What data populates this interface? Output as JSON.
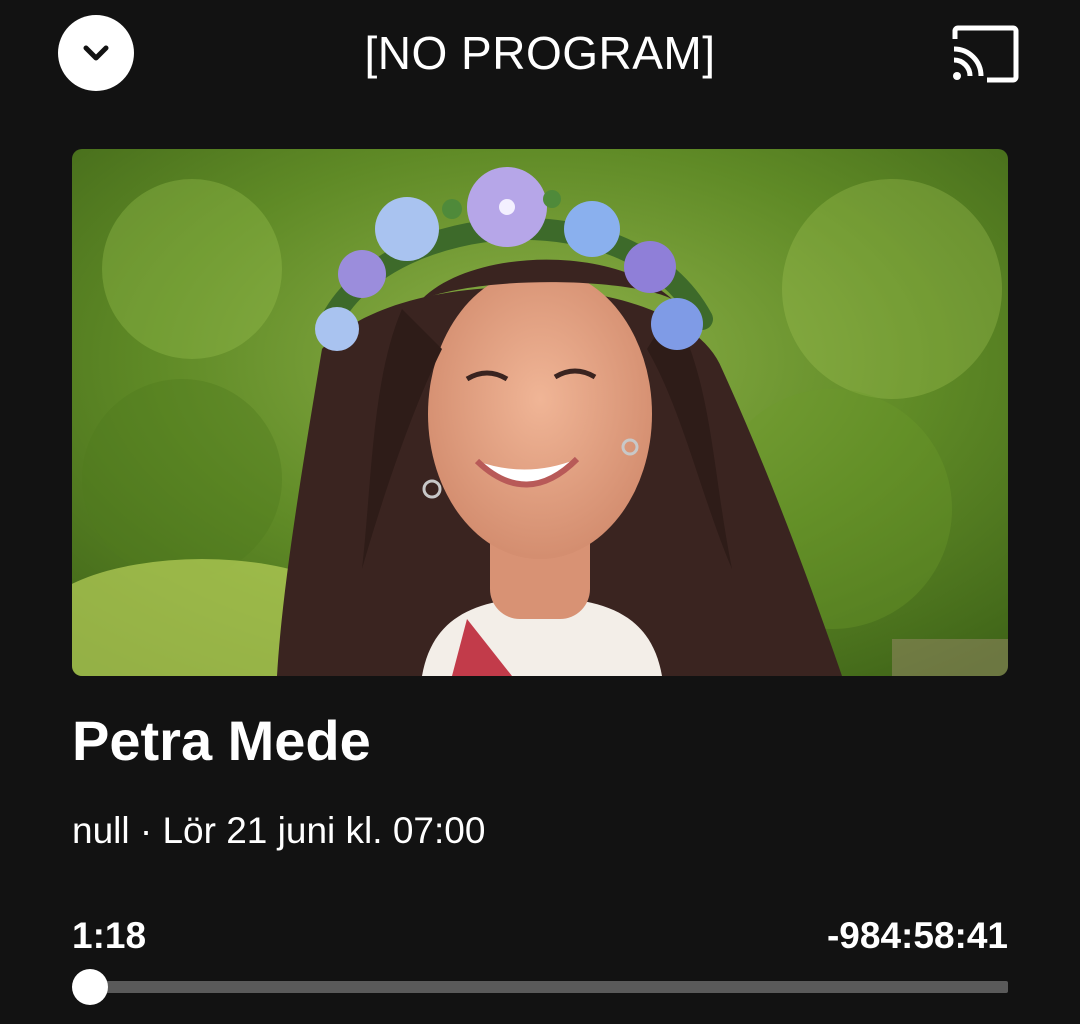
{
  "header": {
    "title": "[NO PROGRAM]",
    "collapse_icon": "chevron-down-icon",
    "cast_icon": "cast-icon"
  },
  "artwork": {
    "subject": "woman with flower crown",
    "background_color": "#6f9a2e",
    "crown_colors": [
      "#a9c3f0",
      "#b6a6e8",
      "#7f8fe0"
    ]
  },
  "episode": {
    "title": "Petra Mede",
    "meta": "null · Lör 21 juni kl. 07:00"
  },
  "player": {
    "elapsed": "1:18",
    "remaining": "-984:58:41",
    "progress_fraction": 0
  },
  "colors": {
    "background": "#121212",
    "text": "#ffffff",
    "track": "#5a5a5a"
  }
}
